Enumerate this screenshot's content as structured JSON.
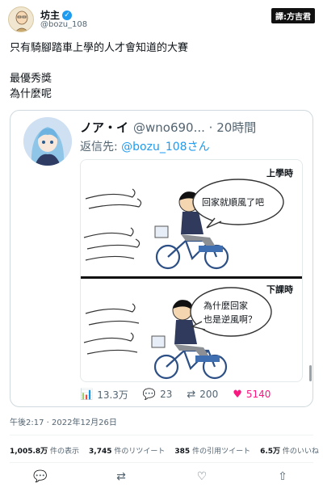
{
  "author": {
    "display_name": "坊主",
    "handle": "@bozu_108"
  },
  "translator_badge": "譯:方吉君",
  "tweet": {
    "lines": [
      "只有騎腳踏車上學的人才會知道的大賽",
      "最優秀獎",
      "為什麼呢"
    ]
  },
  "quote": {
    "display_name": "ノア・イ",
    "handle_time": "@wno690... · 20時間",
    "reply_prefix": "返信先: ",
    "reply_to": "@bozu_108さん",
    "comic": {
      "top_label": "上學時",
      "top_bubble": "回家就順風了吧",
      "bottom_label": "下課時",
      "bottom_bubble_line1": "為什麼回家",
      "bottom_bubble_line2": "也是逆風啊？"
    },
    "stats": {
      "views": "13.3万",
      "replies": "23",
      "retweets": "200",
      "likes": "5140"
    }
  },
  "timestamp": "午後2:17 · 2022年12月26日",
  "metrics": [
    {
      "value": "1,005.8万",
      "label": "件の表示"
    },
    {
      "value": "3,745",
      "label": "件のリツイート"
    },
    {
      "value": "385",
      "label": "件の引用ツイート"
    },
    {
      "value": "6.5万",
      "label": "件のいいね"
    }
  ],
  "colors": {
    "link": "#1d9bf0",
    "like": "#f91880",
    "muted": "#536471",
    "bike": "#3f6fb0"
  }
}
